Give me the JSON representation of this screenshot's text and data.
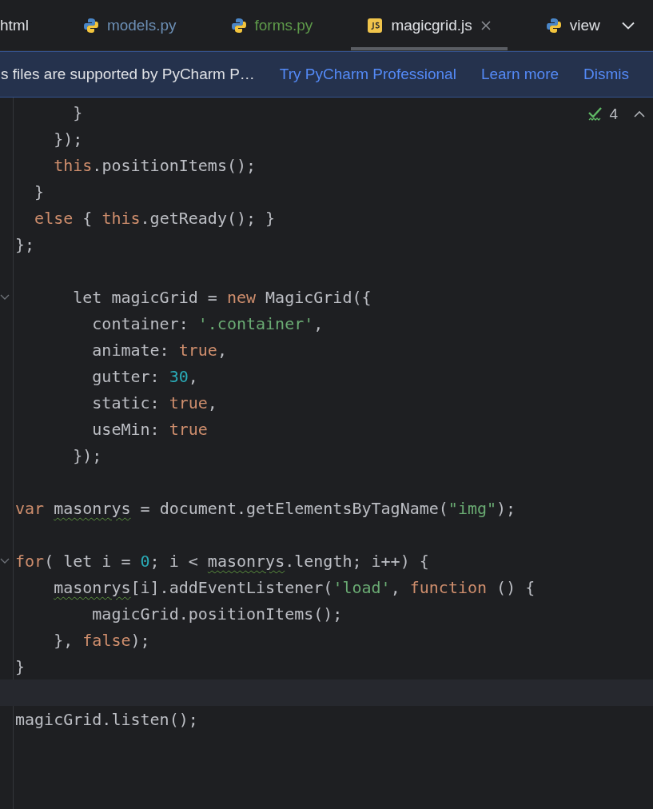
{
  "tabs": [
    {
      "label": "html",
      "kind": "plain",
      "color": "#dfe1e5",
      "selected": false,
      "closable": false
    },
    {
      "label": "models.py",
      "kind": "python",
      "color": "#6c8fb5",
      "selected": false,
      "closable": false
    },
    {
      "label": "forms.py",
      "kind": "python",
      "color": "#5e9a4a",
      "selected": false,
      "closable": false
    },
    {
      "label": "magicgrid.js",
      "kind": "js",
      "color": "#dfe1e5",
      "selected": true,
      "closable": true
    },
    {
      "label": "view",
      "kind": "python",
      "color": "#dfe1e5",
      "selected": false,
      "closable": false
    }
  ],
  "banner": {
    "message": "s files are supported by PyCharm P…",
    "links": [
      "Try PyCharm Professional",
      "Learn more",
      "Dismis"
    ]
  },
  "inspection": {
    "count": "4"
  },
  "code_lines": [
    {
      "tokens": [
        {
          "t": "      }"
        }
      ]
    },
    {
      "tokens": [
        {
          "t": "    });"
        }
      ]
    },
    {
      "tokens": [
        {
          "t": "    this",
          "kind": "kw"
        },
        {
          "t": ".positionItems();"
        }
      ]
    },
    {
      "tokens": [
        {
          "t": "  }"
        }
      ]
    },
    {
      "tokens": [
        {
          "t": "  else",
          "kind": "kw"
        },
        {
          "t": " { "
        },
        {
          "t": "this",
          "kind": "kw"
        },
        {
          "t": ".getReady(); }"
        }
      ]
    },
    {
      "tokens": [
        {
          "t": "};"
        }
      ]
    },
    {
      "fold": true,
      "blank_before": true,
      "tokens": [
        {
          "t": "      let magicGrid = "
        },
        {
          "t": "new",
          "kind": "kw"
        },
        {
          "t": " MagicGrid({"
        }
      ]
    },
    {
      "tokens": [
        {
          "t": "        container: "
        },
        {
          "t": "'.container'",
          "kind": "str"
        },
        {
          "t": ","
        }
      ]
    },
    {
      "tokens": [
        {
          "t": "        animate: "
        },
        {
          "t": "true",
          "kind": "kw"
        },
        {
          "t": ","
        }
      ]
    },
    {
      "tokens": [
        {
          "t": "        gutter: "
        },
        {
          "t": "30",
          "kind": "num"
        },
        {
          "t": ","
        }
      ]
    },
    {
      "tokens": [
        {
          "t": "        static: "
        },
        {
          "t": "true",
          "kind": "kw"
        },
        {
          "t": ","
        }
      ]
    },
    {
      "tokens": [
        {
          "t": "        useMin: "
        },
        {
          "t": "true",
          "kind": "kw"
        }
      ]
    },
    {
      "tokens": [
        {
          "t": "      });"
        }
      ]
    },
    {
      "blank_before": true,
      "tokens": [
        {
          "t": "var",
          "kind": "kw"
        },
        {
          "t": " masonrys",
          "kind": "warn"
        },
        {
          "t": " = document.getElementsByTagName("
        },
        {
          "t": "\"img\"",
          "kind": "str"
        },
        {
          "t": ");"
        }
      ]
    },
    {
      "fold": true,
      "blank_before": true,
      "tokens": [
        {
          "t": "for",
          "kind": "kw"
        },
        {
          "t": "( let i = "
        },
        {
          "t": "0",
          "kind": "num"
        },
        {
          "t": "; i < "
        },
        {
          "t": "masonrys",
          "kind": "warn"
        },
        {
          "t": ".length; i++) {"
        }
      ]
    },
    {
      "tokens": [
        {
          "t": "    masonrys",
          "kind": "warn"
        },
        {
          "t": "[i].addEventListener("
        },
        {
          "t": "'load'",
          "kind": "str"
        },
        {
          "t": ", "
        },
        {
          "t": "function",
          "kind": "kw"
        },
        {
          "t": " () {"
        }
      ]
    },
    {
      "tokens": [
        {
          "t": "        magicGrid.positionItems();"
        }
      ]
    },
    {
      "tokens": [
        {
          "t": "    }, "
        },
        {
          "t": "false",
          "kind": "kw"
        },
        {
          "t": ");"
        }
      ]
    },
    {
      "tokens": [
        {
          "t": "}"
        }
      ]
    },
    {
      "current": true
    },
    {
      "tokens": [
        {
          "t": "magicGrid.listen();"
        }
      ]
    }
  ]
}
